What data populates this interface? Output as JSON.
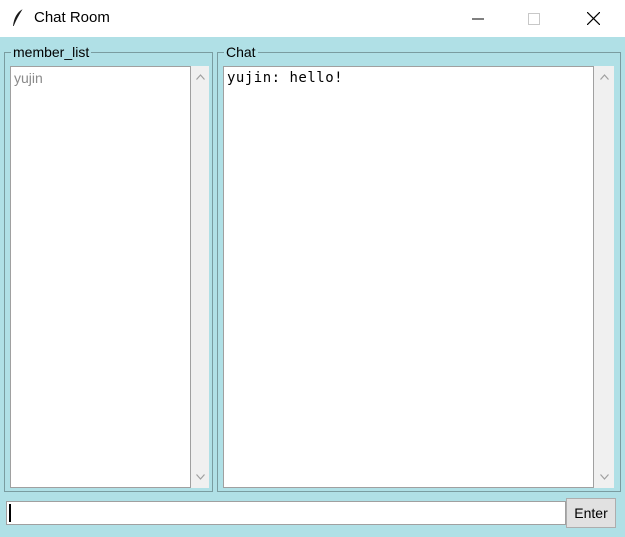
{
  "window": {
    "title": "Chat Room",
    "icons": {
      "app": "feather-icon",
      "minimize": "minimize-icon",
      "maximize": "maximize-icon",
      "close": "close-icon"
    }
  },
  "members": {
    "label": "member_list",
    "items": [
      "yujin"
    ]
  },
  "chat": {
    "label": "Chat",
    "lines": [
      "yujin: hello!"
    ]
  },
  "input": {
    "value": ""
  },
  "enter_button": {
    "label": "Enter"
  },
  "colors": {
    "background": "#b0e0e6",
    "member_text": "#8a8a8a"
  }
}
